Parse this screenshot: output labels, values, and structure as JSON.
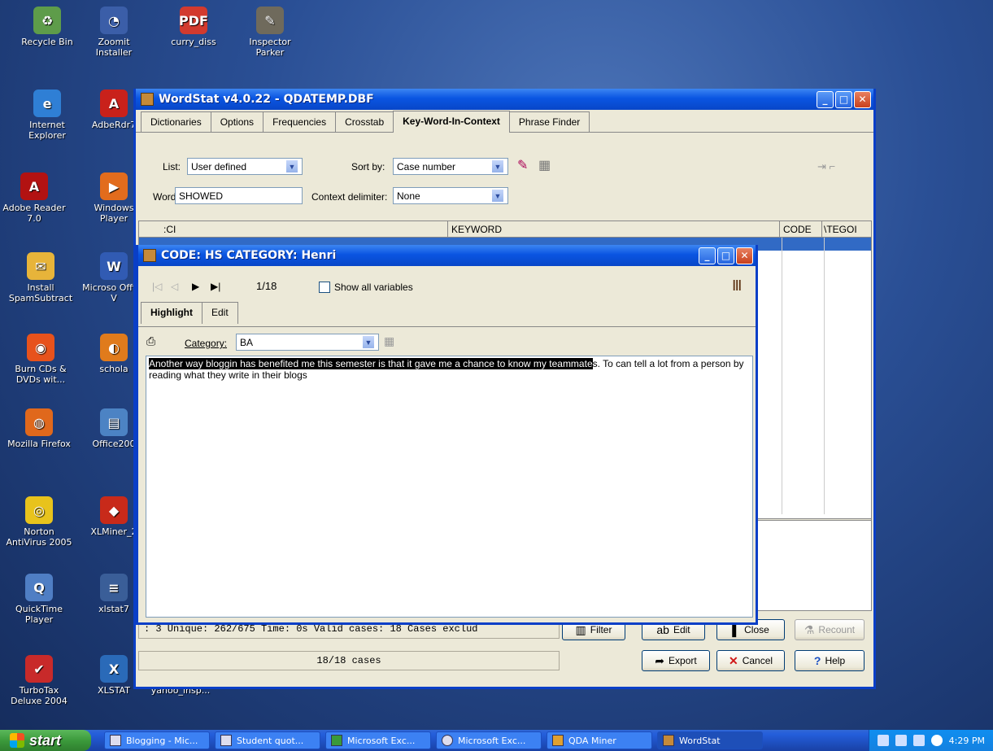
{
  "desktop_icons": [
    {
      "label": "Recycle Bin",
      "color": "#5e9c4a",
      "glyph": "♻"
    },
    {
      "label": "Zoomit Installer",
      "color": "#3b5ea8",
      "glyph": "◔"
    },
    {
      "label": "curry_diss",
      "color": "#d23a2e",
      "glyph": "PDF"
    },
    {
      "label": "Inspector Parker",
      "color": "#6f6a5c",
      "glyph": "✎"
    },
    {
      "label": "Internet Explorer",
      "color": "#2f7fd5",
      "glyph": "e"
    },
    {
      "label": "AdbeRdr7",
      "color": "#c9211b",
      "glyph": "A"
    },
    {
      "label": "Adobe Reader 7.0",
      "color": "#b21212",
      "glyph": "A"
    },
    {
      "label": "Windows Player",
      "color": "#e26c1d",
      "glyph": "▶"
    },
    {
      "label": "Install SpamSubtract",
      "color": "#e7b43a",
      "glyph": "✉"
    },
    {
      "label": "Microso Office V",
      "color": "#315bb3",
      "glyph": "W"
    },
    {
      "label": "Burn CDs & DVDs wit...",
      "color": "#e7521c",
      "glyph": "◉"
    },
    {
      "label": "schola",
      "color": "#e07b1c",
      "glyph": "◐"
    },
    {
      "label": "Mozilla Firefox",
      "color": "#e0681c",
      "glyph": "◍"
    },
    {
      "label": "Office200",
      "color": "#4c83c4",
      "glyph": "▤"
    },
    {
      "label": "Norton AntiVirus 2005",
      "color": "#e8c31c",
      "glyph": "◎"
    },
    {
      "label": "XLMiner_2",
      "color": "#c82a1a",
      "glyph": "◆"
    },
    {
      "label": "QuickTime Player",
      "color": "#4f7ec4",
      "glyph": "Q"
    },
    {
      "label": "xlstat7",
      "color": "#3a5e98",
      "glyph": "≡"
    },
    {
      "label": "TurboTax Deluxe 2004",
      "color": "#c82a2a",
      "glyph": "✔"
    },
    {
      "label": "XLSTAT",
      "color": "#2a6ab8",
      "glyph": "X"
    },
    {
      "label": "yahoo_insp...",
      "color": "#1d3a74",
      "glyph": ""
    }
  ],
  "main_window": {
    "title": "WordStat v4.0.22 - QDATEMP.DBF",
    "tabs": [
      "Dictionaries",
      "Options",
      "Frequencies",
      "Crosstab",
      "Key-Word-In-Context",
      "Phrase Finder"
    ],
    "active_tab": "Key-Word-In-Context",
    "list_label": "List:",
    "list_value": "User defined",
    "sortby_label": "Sort by:",
    "sortby_value": "Case number",
    "word_label": "Word:",
    "word_value": "SHOWED",
    "context_label": "Context delimiter:",
    "context_value": "None",
    "columns": [
      ":CI",
      "KEYWORD",
      "CODE",
      "\\TEGOI"
    ],
    "status_line": ": 3   Unique: 262/675   Time: 0s   Valid cases: 18   Cases exclud",
    "cases": "18/18 cases",
    "buttons": {
      "filter": "Filter",
      "edit": "Edit",
      "close": "Close",
      "recount": "Recount",
      "export": "Export",
      "cancel": "Cancel",
      "help": "Help"
    }
  },
  "code_window": {
    "title": "CODE: HS  CATEGORY: Henri",
    "counter": "1/18",
    "show_all_label": "Show all variables",
    "tabs": [
      "Highlight",
      "Edit"
    ],
    "category_label": "Category:",
    "category_value": "BA",
    "highlighted_text": "Another way bloggin has benefited me this semester is that it gave me a chance to know my teammate",
    "rest_text": "s.  To can tell a lot from a person by reading what they write in their blogs"
  },
  "taskbar": {
    "start": "start",
    "tasks": [
      "Blogging - Mic...",
      "Student quot...",
      "Microsoft Exc...",
      "Microsoft Exc...",
      "QDA Miner",
      "WordStat"
    ],
    "clock": "4:29 PM"
  }
}
